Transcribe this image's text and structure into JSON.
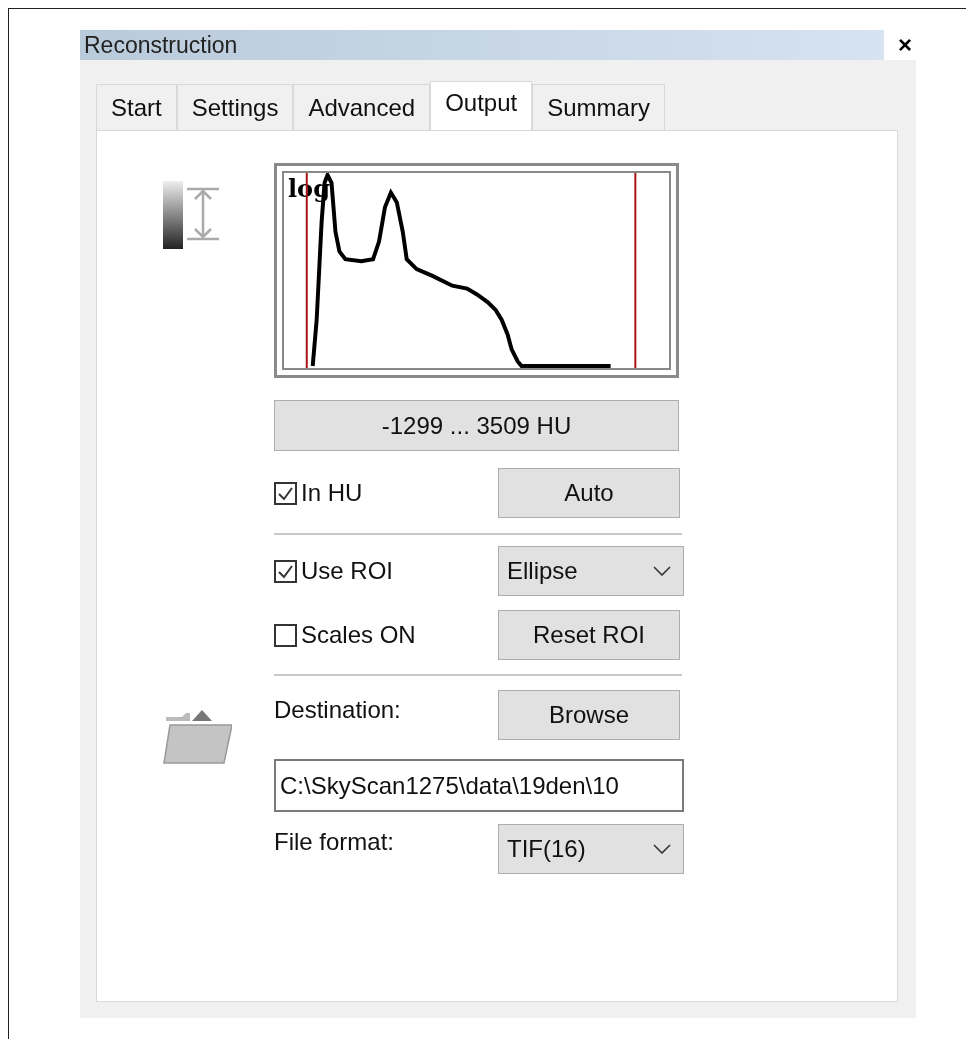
{
  "window": {
    "title": "Reconstruction",
    "close": "×"
  },
  "tabs": [
    {
      "label": "Start",
      "selected": false
    },
    {
      "label": "Settings",
      "selected": false
    },
    {
      "label": "Advanced",
      "selected": false
    },
    {
      "label": "Output",
      "selected": true
    },
    {
      "label": "Summary",
      "selected": false
    }
  ],
  "histogram": {
    "label": "log"
  },
  "range_button": "-1299 ... 3509 HU",
  "in_hu": {
    "label": "In HU",
    "checked": true
  },
  "auto_button": "Auto",
  "use_roi": {
    "label": "Use ROI",
    "checked": true
  },
  "roi_shape": {
    "value": "Ellipse"
  },
  "scales_on": {
    "label": "Scales ON",
    "checked": false
  },
  "reset_roi_button": "Reset ROI",
  "destination": {
    "label": "Destination:",
    "browse_button": "Browse",
    "value": "C:\\SkyScan1275\\data\\19den\\10"
  },
  "file_format": {
    "label": "File format:",
    "value": "TIF(16)"
  }
}
